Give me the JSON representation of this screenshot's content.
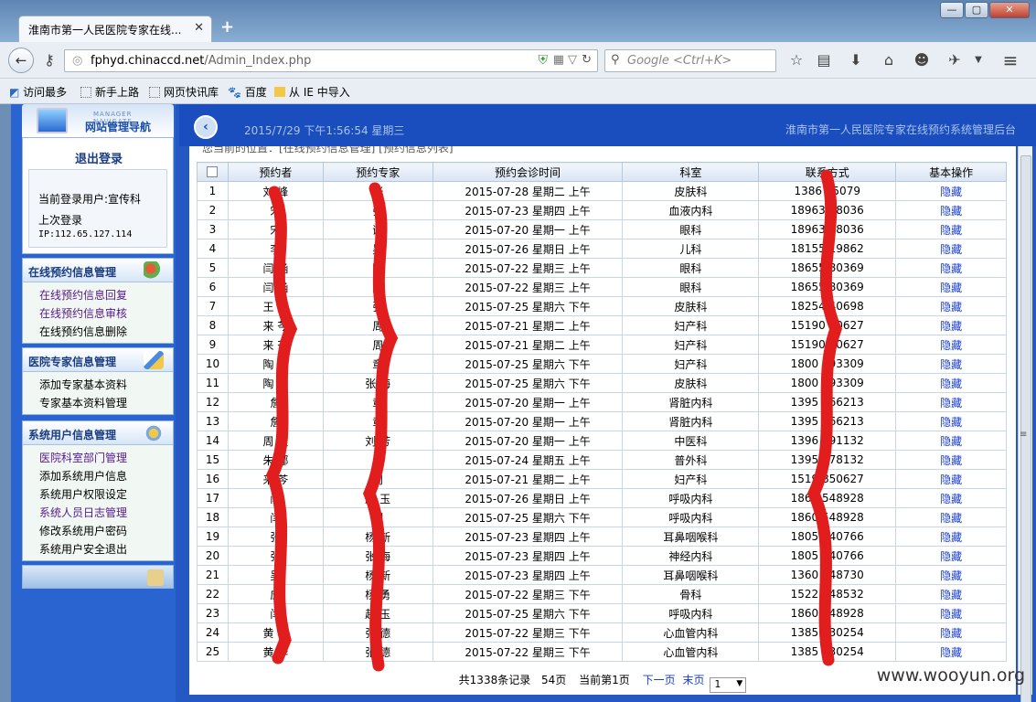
{
  "browser": {
    "tab_title": "淮南市第一人民医院专家在线...",
    "tab_close": "✕",
    "new_tab": "+",
    "url_host": "fphyd.chinaccd.net",
    "url_path": "/Admin_Index.php",
    "search_placeholder": "Google <Ctrl+K>",
    "bookmarks": [
      "访问最多",
      "新手上路",
      "网页快讯库",
      "百度",
      "从 IE 中导入"
    ]
  },
  "header": {
    "datetime": "2015/7/29 下午1:56:54 星期三",
    "system_title": "淮南市第一人民医院专家在线预约系统管理后台"
  },
  "sidebar": {
    "brand_sub": "MANAGER NAVIGATE",
    "brand_title": "网站管理导航",
    "logout": "退出登录",
    "current_user": "当前登录用户:宣传科",
    "last_login_label": "上次登录",
    "last_login_ip": "IP:112.65.127.114",
    "groups": [
      {
        "title": "在线预约信息管理",
        "items": [
          "在线预约信息回复",
          "在线预约信息审核",
          "在线预约信息删除"
        ]
      },
      {
        "title": "医院专家信息管理",
        "items": [
          "添加专家基本资料",
          "专家基本资料管理"
        ]
      },
      {
        "title": "系统用户信息管理",
        "items": [
          "医院科室部门管理",
          "添加系统用户信息",
          "系统用户权限设定",
          "系统人员日志管理",
          "修改系统用户密码",
          "系统用户安全退出"
        ]
      }
    ]
  },
  "breadcrumb": "您当前的位置：[在线预约信息管理] [预约信息列表]",
  "table": {
    "headers": [
      "预约者",
      "预约专家",
      "预约会诊时间",
      "科室",
      "联系方式",
      "基本操作"
    ],
    "rows": [
      [
        "1",
        "刘 峰",
        "张 ",
        "2015-07-28 星期二 上午",
        "皮肤科",
        "1386  65079",
        "隐藏"
      ],
      [
        "2",
        "宋 ",
        "张 ",
        "2015-07-23 星期四 上午",
        "血液内科",
        "18963 78036",
        "隐藏"
      ],
      [
        "3",
        "宋 ",
        "谢 ",
        "2015-07-20 星期一 上午",
        "眼科",
        "18963 78036",
        "隐藏"
      ],
      [
        "4",
        "李 ",
        "吴 ",
        "2015-07-26 星期日 上午",
        "儿科",
        "18155 19862",
        "隐藏"
      ],
      [
        "5",
        "闫 涵",
        "陈 ",
        "2015-07-22 星期三 上午",
        "眼科",
        "18655 80369",
        "隐藏"
      ],
      [
        "6",
        "闫 涵",
        "陈 ",
        "2015-07-22 星期三 上午",
        "眼科",
        "18655 80369",
        "隐藏"
      ],
      [
        "7",
        "王 丹",
        "张 ",
        "2015-07-25 星期六 下午",
        "皮肤科",
        "18254 40698",
        "隐藏"
      ],
      [
        "8",
        "来 芩",
        "周 ",
        "2015-07-21 星期二 上午",
        "妇产科",
        "15190 50627",
        "隐藏"
      ],
      [
        "9",
        "来 芩",
        "周 ",
        "2015-07-21 星期二 上午",
        "妇产科",
        "15190 50627",
        "隐藏"
      ],
      [
        "10",
        "陶 云",
        "章 ",
        "2015-07-25 星期六 下午",
        "妇产科",
        "1800 693309",
        "隐藏"
      ],
      [
        "11",
        "陶 云",
        "张 海",
        "2015-07-25 星期六 下午",
        "皮肤科",
        "1800 693309",
        "隐藏"
      ],
      [
        "12",
        "詹 ",
        "章 ",
        "2015-07-20 星期一 上午",
        "肾脏内科",
        "1395 566213",
        "隐藏"
      ],
      [
        "13",
        "詹 ",
        "章 ",
        "2015-07-20 星期一 上午",
        "肾脏内科",
        "1395 566213",
        "隐藏"
      ],
      [
        "14",
        "周 敏",
        "刘 芳",
        "2015-07-20 星期一 上午",
        "中医科",
        "1396 491132",
        "隐藏"
      ],
      [
        "15",
        "朱 娜",
        "周 ",
        "2015-07-24 星期五 上午",
        "普外科",
        "1395 478132",
        "隐藏"
      ],
      [
        "16",
        "来 芩",
        "周 ",
        "2015-07-21 星期二 上午",
        "妇产科",
        "1519 850627",
        "隐藏"
      ],
      [
        "17",
        "闫 ",
        "赵 玉",
        "2015-07-26 星期日 上午",
        "呼吸内科",
        "1860 548928",
        "隐藏"
      ],
      [
        "18",
        "闫 ",
        "刘 ",
        "2015-07-25 星期六 下午",
        "呼吸内科",
        "1860 548928",
        "隐藏"
      ],
      [
        "19",
        "张 ",
        "杨 新",
        "2015-07-23 星期四 上午",
        "耳鼻咽喉科",
        "1805 540766",
        "隐藏"
      ],
      [
        "20",
        "张 ",
        "张 海",
        "2015-07-23 星期四 上午",
        "神经内科",
        "1805 540766",
        "隐藏"
      ],
      [
        "21",
        "吴 ",
        "杨 新",
        "2015-07-23 星期四 上午",
        "耳鼻咽喉科",
        "1360 548730",
        "隐藏"
      ],
      [
        "22",
        "应 ",
        "杨 勇",
        "2015-07-22 星期三 下午",
        "骨科",
        "1522 548532",
        "隐藏"
      ],
      [
        "23",
        "闫 ",
        "赵 玉",
        "2015-07-25 星期六 下午",
        "呼吸内科",
        "1860 548928",
        "隐藏"
      ],
      [
        "24",
        "黄 华",
        "张 德",
        "2015-07-22 星期三 下午",
        "心血管内科",
        "1385 030254",
        "隐藏"
      ],
      [
        "25",
        "黄 华",
        "张 德",
        "2015-07-22 星期三 下午",
        "心血管内科",
        "1385 030254",
        "隐藏"
      ]
    ]
  },
  "pager": {
    "total": "共1338条记录",
    "pages": "54页",
    "current": "当前第1页",
    "next": "下一页",
    "last": "末页",
    "select_value": "1"
  },
  "watermark": "www.wooyun.org",
  "colors": {
    "brand_blue": "#1a4dbd",
    "redaction": "#e21d1d",
    "link": "#1a3fd4"
  },
  "icons": [
    "key-icon",
    "star-icon",
    "reading-list-icon",
    "download-icon",
    "home-icon",
    "chat-icon",
    "menu-icon",
    "refresh-icon",
    "shield-icon",
    "qr-icon"
  ]
}
